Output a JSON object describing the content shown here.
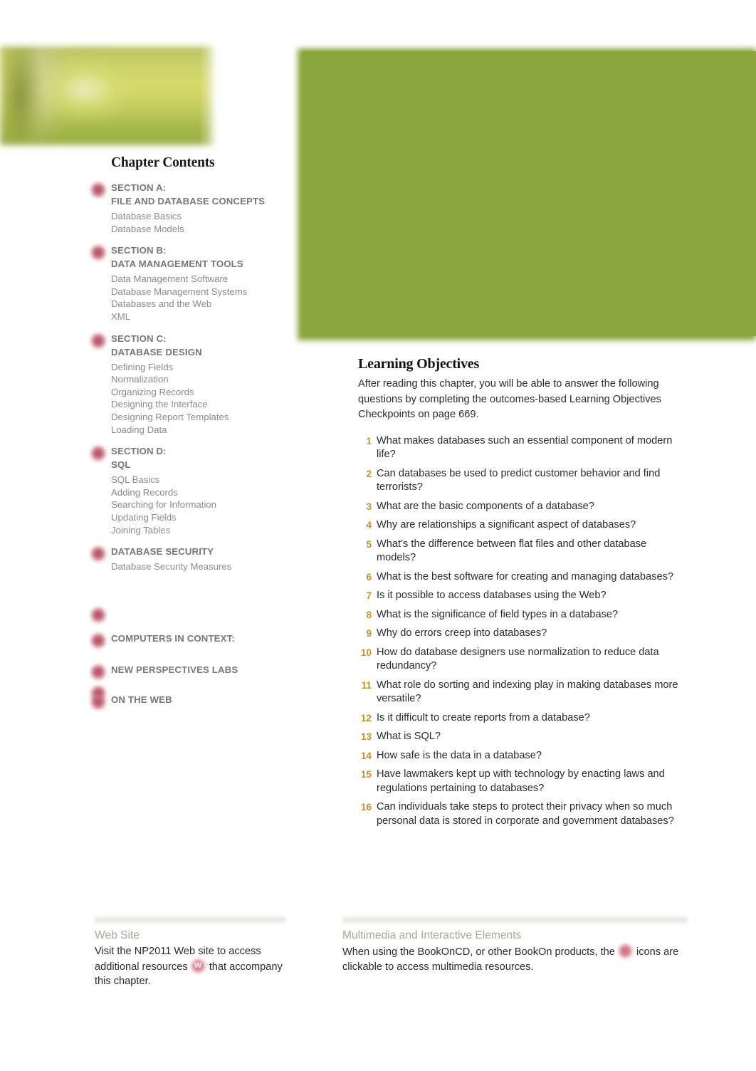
{
  "banner": {
    "photo_alt": "blurred yellow-green nature photograph",
    "green_panel_color": "#8aa63e",
    "photo_accent_color": "#cdd36a"
  },
  "sidebar": {
    "title": "Chapter Contents",
    "icon_color": "#b3485a",
    "groups": [
      {
        "icon": "multimedia-icon",
        "section": "SECTION A:",
        "name": "FILE AND DATABASE CONCEPTS",
        "items": [
          "Database Basics",
          "Database Models"
        ]
      },
      {
        "icon": "multimedia-icon",
        "section": "SECTION B:",
        "name": "DATA MANAGEMENT TOOLS",
        "items": [
          "Data Management Software",
          "Database Management Systems",
          "Databases and the Web",
          "XML"
        ]
      },
      {
        "icon": "multimedia-icon",
        "section": "SECTION C:",
        "name": "DATABASE DESIGN",
        "items": [
          "Defining Fields",
          "Normalization",
          "Organizing Records",
          "Designing the Interface",
          "Designing Report Templates",
          "Loading Data"
        ]
      },
      {
        "icon": "multimedia-icon",
        "section": "SECTION D:",
        "name": "SQL",
        "items": [
          "SQL Basics",
          "Adding Records",
          "Searching for Information",
          "Updating Fields",
          "Joining Tables"
        ]
      },
      {
        "icon": "multimedia-icon",
        "section": "",
        "name": "DATABASE SECURITY",
        "items": [
          "Database Security Measures"
        ]
      },
      {
        "icon": "multimedia-icon",
        "section": "",
        "name": "",
        "items": []
      },
      {
        "icon": "multimedia-icon",
        "section": "",
        "name": "COMPUTERS IN CONTEXT:",
        "items": []
      },
      {
        "icon": "multimedia-icon",
        "section": "",
        "name": "NEW PERSPECTIVES LABS",
        "items": []
      },
      {
        "icon": "multimedia-icon",
        "section": "",
        "name": "",
        "items": []
      },
      {
        "icon": "multimedia-icon",
        "section": "",
        "name": "ON THE WEB",
        "items": []
      }
    ]
  },
  "objectives": {
    "title": "Learning Objectives",
    "intro": "After reading this chapter, you will be able to answer the following questions by completing the outcomes-based Learning Objectives Checkpoints on page 669.",
    "number_color": "#c9921c",
    "questions": [
      {
        "num": "1",
        "text": "What makes databases such an essential component of modern life?"
      },
      {
        "num": "2",
        "text": "Can databases be used to predict customer behavior and find terrorists?"
      },
      {
        "num": "3",
        "text": "What are the basic components of a database?"
      },
      {
        "num": "4",
        "text": "Why are relationships a significant aspect of databases?"
      },
      {
        "num": "5",
        "text": "What’s the difference between flat files and other database models?"
      },
      {
        "num": "6",
        "text": "What is the best software for creating and managing databases?"
      },
      {
        "num": "7",
        "text": "Is it possible to access databases using the Web?"
      },
      {
        "num": "8",
        "text": "What is the significance of field types in a database?"
      },
      {
        "num": "9",
        "text": "Why do errors creep into databases?"
      },
      {
        "num": "10",
        "text": "How do database designers use normalization to reduce data redundancy?"
      },
      {
        "num": "11",
        "text": "What role do sorting and indexing play in making databases more versatile?"
      },
      {
        "num": "12",
        "text": "Is it difficult to create reports from a database?"
      },
      {
        "num": "13",
        "text": "What is SQL?"
      },
      {
        "num": "14",
        "text": "How safe is the data in a database?"
      },
      {
        "num": "15",
        "text": "Have lawmakers kept up with technology by enacting laws and regulations pertaining to databases?"
      },
      {
        "num": "16",
        "text": "Can individuals take steps to protect their privacy when so much personal data is stored in corporate and government databases?"
      }
    ]
  },
  "footer": {
    "left": {
      "heading": "Web Site",
      "text_before_icon": "Visit the NP2011 Web site to access additional resources",
      "icon_label": "W",
      "text_after_icon": "that accompany this chapter."
    },
    "right": {
      "heading": "Multimedia and Interactive Elements",
      "text_before_icon": "When using the BookOnCD, or other BookOn products, the",
      "icon_label": "",
      "text_after_icon": "icons are clickable to access multimedia resources."
    }
  }
}
